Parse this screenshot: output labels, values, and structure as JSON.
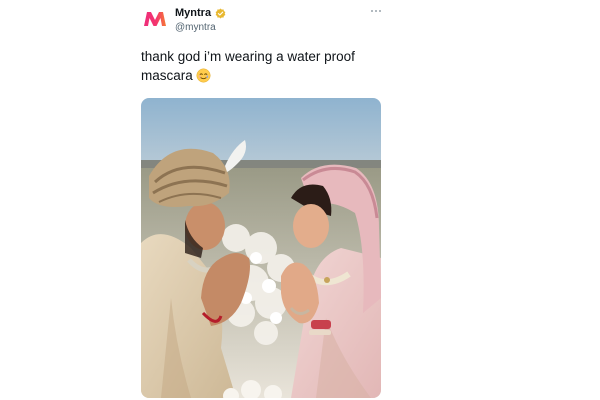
{
  "tweet": {
    "display_name": "Myntra",
    "handle": "@myntra",
    "text": "thank god i’m wearing a water proof mascara",
    "emoji": "smiling-face-with-tear-emoji",
    "verified": true
  },
  "icons": {
    "avatar": "myntra-logo-icon",
    "verified": "verified-badge-icon",
    "more": "more-options-icon"
  },
  "colors": {
    "text": "#0f1419",
    "secondary_text": "#536471",
    "verified_badge": "#e8b830",
    "logo_pink": "#ee2d7a",
    "logo_orange": "#f57b34"
  }
}
